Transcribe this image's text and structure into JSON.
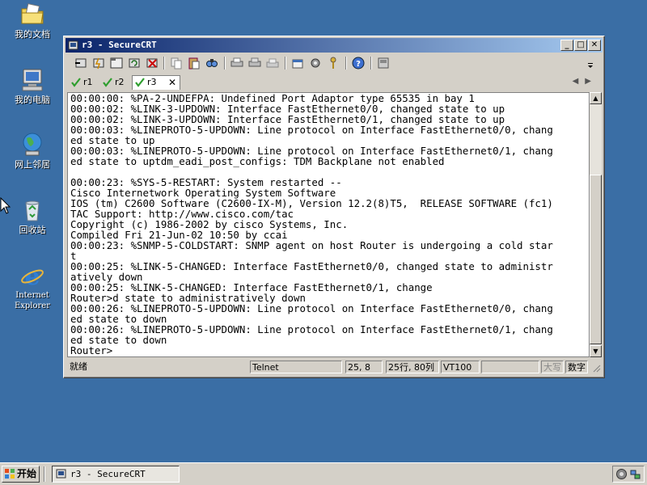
{
  "desktop": {
    "icons": [
      {
        "label": "我的文档",
        "icon": "folder-documents-icon"
      },
      {
        "label": "我的电脑",
        "icon": "my-computer-icon"
      },
      {
        "label": "网上邻居",
        "icon": "network-places-icon"
      },
      {
        "label": "回收站",
        "icon": "recycle-bin-icon"
      },
      {
        "label": "Internet\nExplorer",
        "icon": "internet-explorer-icon"
      }
    ]
  },
  "window": {
    "title": "r3 - SecureCRT",
    "minimize": "_",
    "maximize": "□",
    "close": "✕",
    "tabs": [
      {
        "label": "r1",
        "active": false
      },
      {
        "label": "r2",
        "active": false
      },
      {
        "label": "r3",
        "active": true
      }
    ],
    "tab_close": "✕",
    "tab_arrows": "◀▶"
  },
  "terminal": {
    "lines": [
      "00:00:00: %PA-2-UNDEFPA: Undefined Port Adaptor type 65535 in bay 1",
      "00:00:02: %LINK-3-UPDOWN: Interface FastEthernet0/0, changed state to up",
      "00:00:02: %LINK-3-UPDOWN: Interface FastEthernet0/1, changed state to up",
      "00:00:03: %LINEPROTO-5-UPDOWN: Line protocol on Interface FastEthernet0/0, chang",
      "ed state to up",
      "00:00:03: %LINEPROTO-5-UPDOWN: Line protocol on Interface FastEthernet0/1, chang",
      "ed state to uptdm_eadi_post_configs: TDM Backplane not enabled",
      "",
      "00:00:23: %SYS-5-RESTART: System restarted --",
      "Cisco Internetwork Operating System Software",
      "IOS (tm) C2600 Software (C2600-IX-M), Version 12.2(8)T5,  RELEASE SOFTWARE (fc1)",
      "TAC Support: http://www.cisco.com/tac",
      "Copyright (c) 1986-2002 by cisco Systems, Inc.",
      "Compiled Fri 21-Jun-02 10:50 by ccai",
      "00:00:23: %SNMP-5-COLDSTART: SNMP agent on host Router is undergoing a cold star",
      "t",
      "00:00:25: %LINK-5-CHANGED: Interface FastEthernet0/0, changed state to administr",
      "atively down",
      "00:00:25: %LINK-5-CHANGED: Interface FastEthernet0/1, change",
      "Router>d state to administratively down",
      "00:00:26: %LINEPROTO-5-UPDOWN: Line protocol on Interface FastEthernet0/0, chang",
      "ed state to down",
      "00:00:26: %LINEPROTO-5-UPDOWN: Line protocol on Interface FastEthernet0/1, chang",
      "ed state to down",
      "Router>"
    ]
  },
  "statusbar": {
    "ready": "就绪",
    "protocol": "Telnet",
    "cursor_pos": "25,  8",
    "size": "25行, 80列",
    "emulation": "VT100",
    "caps": "大写",
    "num": "数字"
  },
  "taskbar": {
    "start_label": "开始",
    "task_label": "r3 - SecureCRT"
  },
  "colors": {
    "desktop": "#3a6ea5",
    "titlebar_start": "#0a246a",
    "titlebar_end": "#a6caf0",
    "window_face": "#d4d0c8",
    "tab_check": "#2e9e2e"
  }
}
